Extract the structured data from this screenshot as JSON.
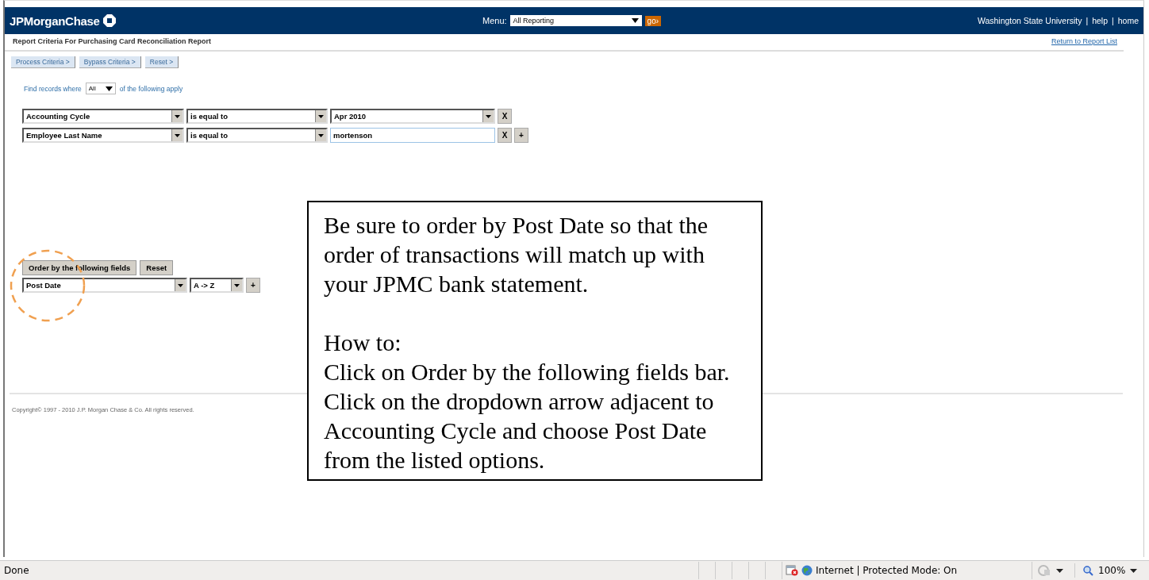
{
  "header": {
    "logo": "JPMorganChase",
    "menu_label": "Menu:",
    "menu_value": "All Reporting",
    "go_button": "go›",
    "links": [
      "Washington State University",
      "help",
      "home"
    ],
    "separator": "|"
  },
  "page_title": "Report Criteria For Purchasing Card Reconciliation Report",
  "return_link": "Return to Report List",
  "actions": [
    "Process Criteria >",
    "Bypass Criteria >",
    "Reset >"
  ],
  "find": {
    "prefix": "Find records where",
    "match_value": "All",
    "suffix": "of the following apply"
  },
  "criteria": [
    {
      "field": "Accounting Cycle",
      "operator": "is equal to",
      "kind": "select",
      "value": "Apr 2010",
      "remove": "X"
    },
    {
      "field": "Employee Last Name",
      "operator": "is equal to",
      "kind": "text",
      "value": "mortenson",
      "remove": "X",
      "add": "+"
    }
  ],
  "order": {
    "button": "Order by the following fields",
    "reset": "Reset",
    "field": "Post Date",
    "direction": "A -> Z",
    "add": "+"
  },
  "copyright": "Copyright© 1997 - 2010 J.P. Morgan Chase & Co. All rights reserved.",
  "callout": {
    "paragraphs": [
      "Be sure to order by Post Date so that the order of transactions will match up with your JPMC bank statement.",
      "How to:",
      "Click on Order by the following fields bar.  Click on the dropdown arrow adjacent to Accounting Cycle and choose Post Date from the listed options."
    ]
  },
  "status_bar": {
    "text": "Done",
    "zone": "Internet | Protected Mode: On",
    "zoom": "100%"
  }
}
